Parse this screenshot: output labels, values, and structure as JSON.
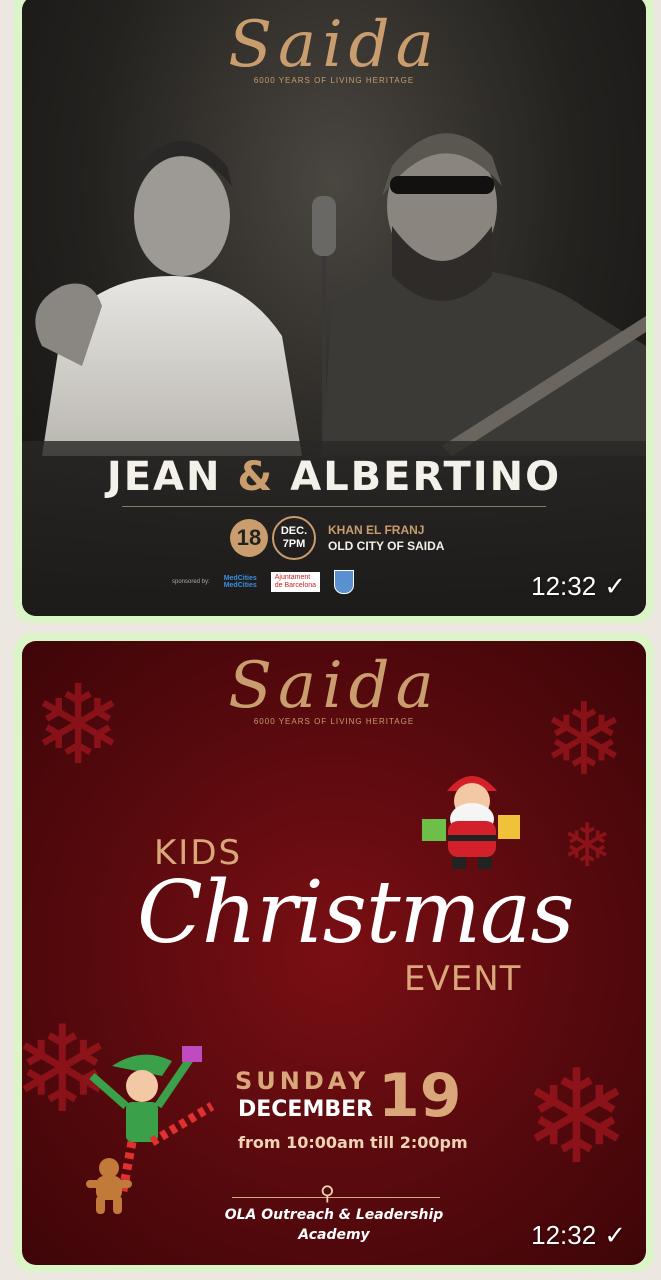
{
  "messages": [
    {
      "poster": {
        "logo": "Saida",
        "logo_tagline": "6000 YEARS OF LIVING HERITAGE",
        "artist_left": "JEAN",
        "artist_amp": "&",
        "artist_right": "ALBERTINO",
        "date_day": "18",
        "date_month": "DEC.",
        "date_time": "7PM",
        "venue_line1": "KHAN EL FRANJ",
        "venue_line2": "OLD CITY OF SAIDA",
        "sponsor_label": "sponsored by:",
        "sponsor_med1": "MedCities",
        "sponsor_med2": "MedCities",
        "sponsor_bcn1": "Ajuntament",
        "sponsor_bcn2": "de Barcelona"
      },
      "time": "12:32",
      "status": "✓"
    },
    {
      "poster": {
        "logo": "Saida",
        "logo_tagline": "6000 YEARS OF LIVING HERITAGE",
        "kids": "KIDS",
        "christmas": "Christmas",
        "event": "EVENT",
        "weekday": "SUNDAY",
        "month": "DECEMBER",
        "day": "19",
        "hours": "from 10:00am till 2:00pm",
        "academy_line1": "OLA Outreach & Leadership",
        "academy_line2": "Academy"
      },
      "time": "12:32",
      "status": "✓"
    }
  ],
  "colors": {
    "bubble": "#dcf5c8",
    "gold": "#c99d6d",
    "poster2_bg": "#5a0a0e"
  }
}
